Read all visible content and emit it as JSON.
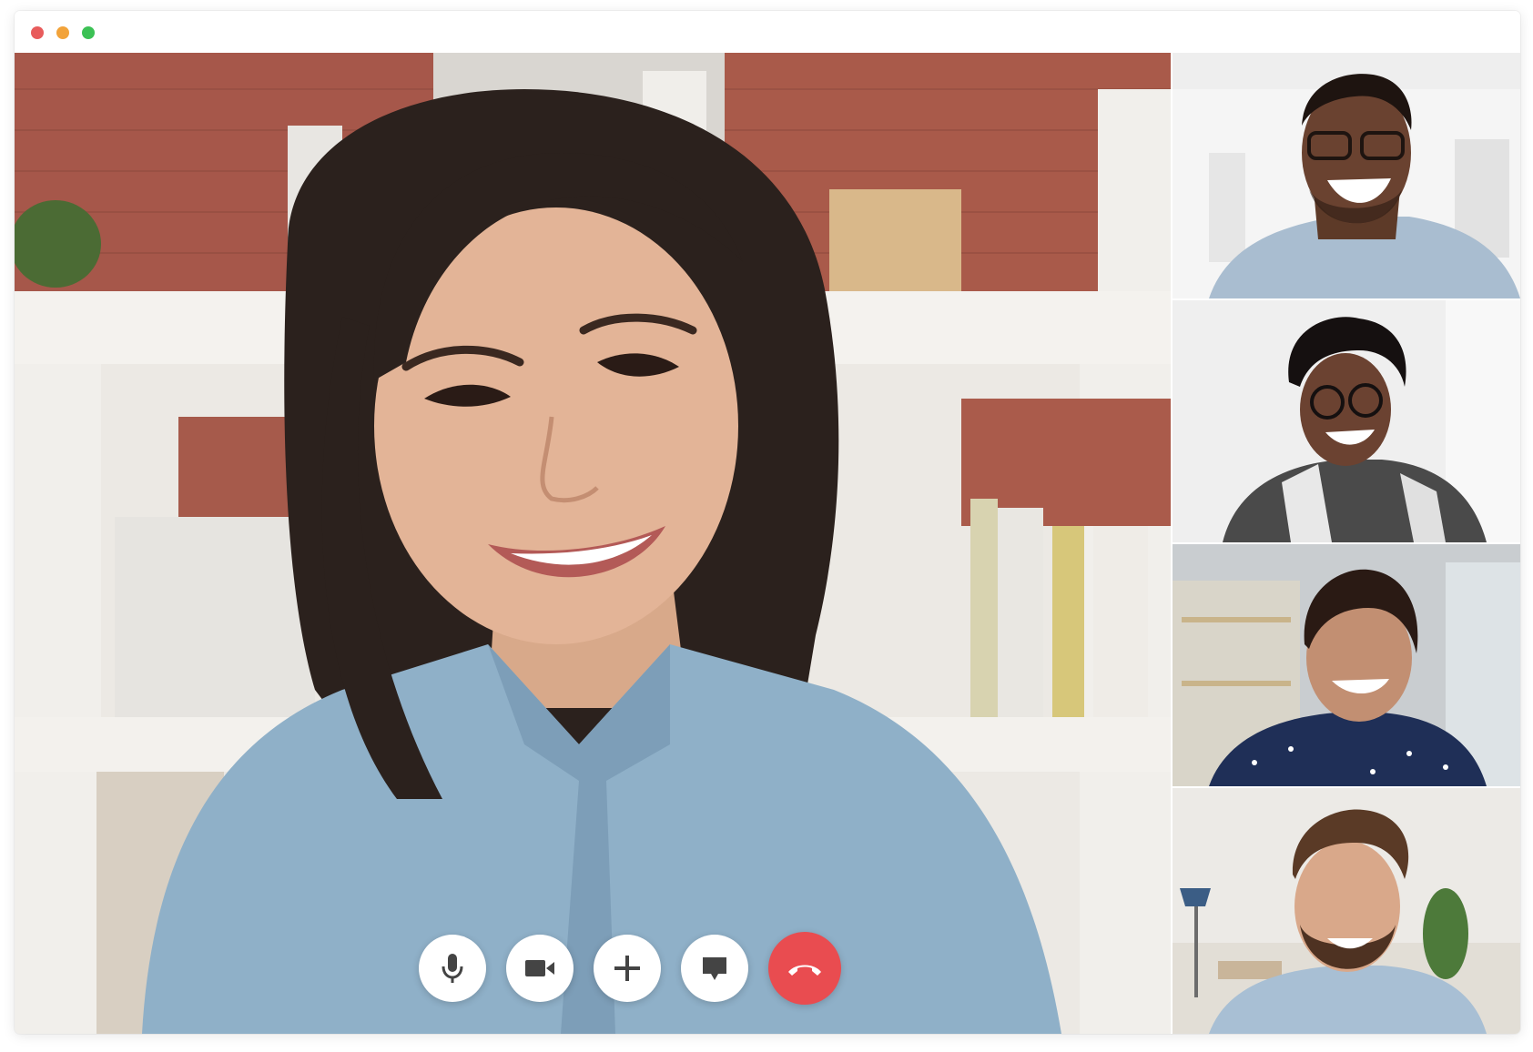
{
  "window": {
    "traffic_lights": [
      "#e85c5c",
      "#f2a33a",
      "#3cc155"
    ]
  },
  "call": {
    "main_speaker": {
      "icon": "main-speaker-video"
    },
    "participants": [
      {
        "icon": "participant-video-1"
      },
      {
        "icon": "participant-video-2"
      },
      {
        "icon": "participant-video-3"
      },
      {
        "icon": "participant-video-4"
      }
    ],
    "controls": [
      {
        "action": "mute-microphone",
        "icon": "microphone-icon"
      },
      {
        "action": "toggle-camera",
        "icon": "video-camera-icon"
      },
      {
        "action": "add-participant",
        "icon": "plus-icon"
      },
      {
        "action": "open-chat",
        "icon": "chat-bubble-icon"
      },
      {
        "action": "end-call",
        "icon": "phone-hangup-icon",
        "color": "#e94c50"
      }
    ]
  }
}
